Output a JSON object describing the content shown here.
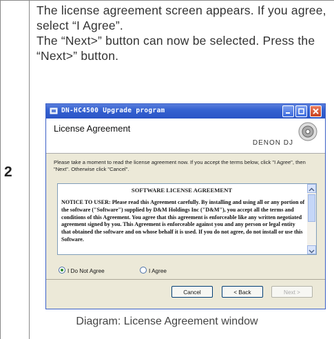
{
  "step_number": "2",
  "instructions": [
    "The license agreement screen appears. If you agree, select “I Agree”.",
    "The “Next>” button can now be selected. Press the “Next>” button."
  ],
  "window": {
    "title": "DN-HC4500 Upgrade program",
    "header_title": "License Agreement",
    "brand": "DENON DJ",
    "description": "Please take a moment to read the license agreement now. If you accept the terms below, click \"I Agree\", then \"Next\". Otherwise click \"Cancel\".",
    "license_title": "SOFTWARE LICENSE AGREEMENT",
    "license_text": "NOTICE TO USER: Please read this Agreement carefully. By installing and using all or any portion of the software (\"Software\") supplied by D&M Holdings Inc (\"D&M\"), you accept all the terms and conditions of this Agreement. You agree that this agreement is enforceable like any written negotiated agreement signed by you. This Agreement is enforceable against you and any person or legal entity that obtained the software and on whose behalf it is used. If you do not agree, do not install or use this Software.",
    "radio_disagree": "I Do Not Agree",
    "radio_agree": "I Agree",
    "selected": "I Do Not Agree",
    "btn_cancel": "Cancel",
    "btn_back": "< Back",
    "btn_next": "Next >"
  },
  "caption": "Diagram: License Agreement window"
}
